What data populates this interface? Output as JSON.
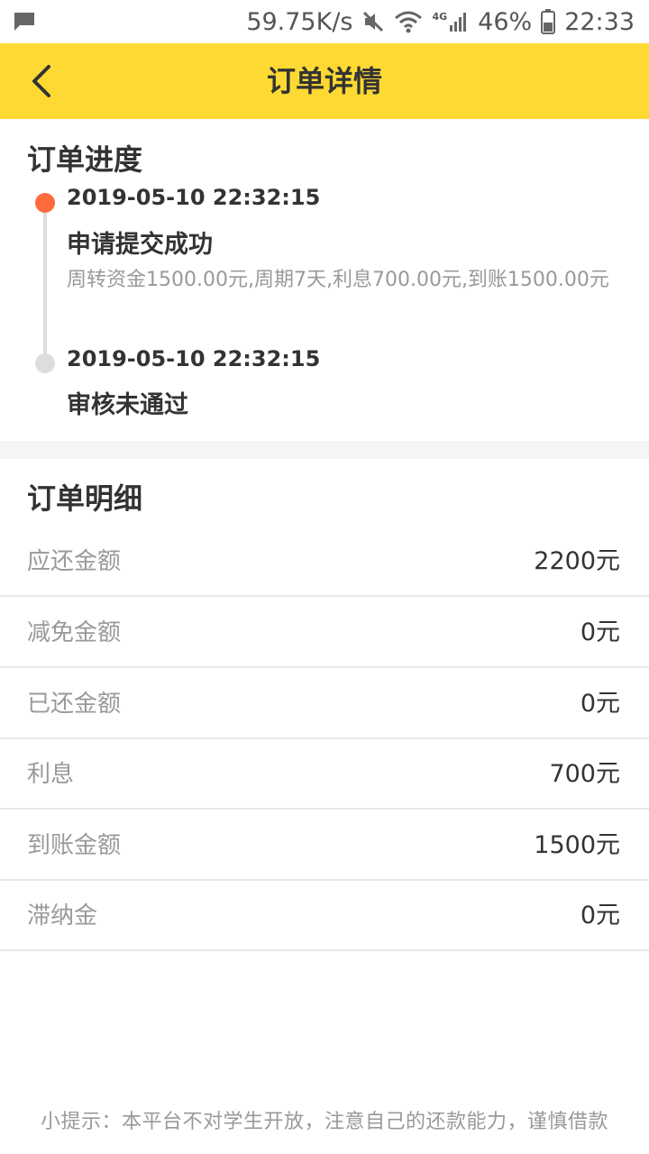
{
  "status_bar": {
    "net_speed": "59.75K/s",
    "network_label": "4G",
    "battery": "46%",
    "time": "22:33"
  },
  "header": {
    "title": "订单详情"
  },
  "progress": {
    "title": "订单进度",
    "steps": [
      {
        "time": "2019-05-10 22:32:15",
        "title": "申请提交成功",
        "desc": "周转资金1500.00元,周期7天,利息700.00元,到账1500.00元"
      },
      {
        "time": "2019-05-10 22:32:15",
        "title": "审核未通过"
      }
    ]
  },
  "details": {
    "title": "订单明细",
    "rows": [
      {
        "label": "应还金额",
        "value": "2200元"
      },
      {
        "label": "减免金额",
        "value": "0元"
      },
      {
        "label": "已还金额",
        "value": "0元"
      },
      {
        "label": "利息",
        "value": "700元"
      },
      {
        "label": "到账金额",
        "value": "1500元"
      },
      {
        "label": "滞纳金",
        "value": "0元"
      }
    ]
  },
  "footer": {
    "tip": "小提示：本平台不对学生开放，注意自己的还款能力，谨慎借款"
  },
  "colors": {
    "header_bg": "#FFD933",
    "active_dot": "#FF6A3D",
    "inactive_dot": "#DDDDDD"
  }
}
